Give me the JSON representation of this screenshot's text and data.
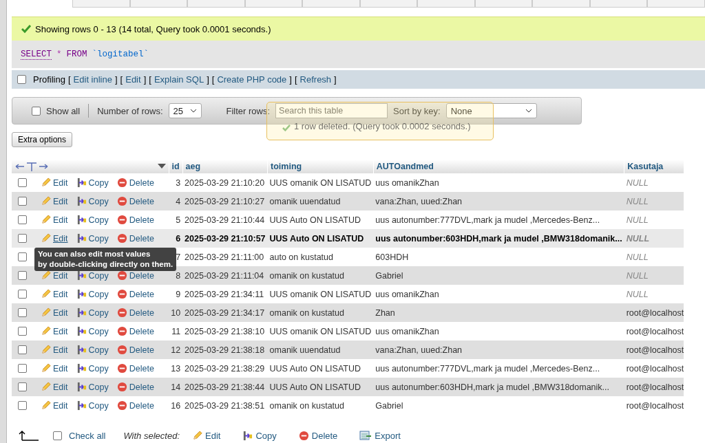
{
  "success": {
    "message": "Showing rows 0 - 13 (14 total, Query took 0.0001 seconds.)"
  },
  "sql": {
    "keyword_select": "SELECT",
    "star": "*",
    "keyword_from": "FROM",
    "table": "`logitabel`"
  },
  "profiling": {
    "label": "Profiling",
    "checked": false,
    "links": [
      {
        "open": "[",
        "label": "Edit inline",
        "close": "]"
      },
      {
        "open": "[",
        "label": "Edit",
        "close": "]"
      },
      {
        "open": "[",
        "label": "Explain SQL",
        "close": "]"
      },
      {
        "open": "[",
        "label": "Create PHP code",
        "close": "]"
      },
      {
        "open": "[",
        "label": "Refresh",
        "close": "]"
      }
    ]
  },
  "filter_bar": {
    "show_all": {
      "label": "Show all",
      "checked": false
    },
    "rows_label": "Number of rows:",
    "rows_value": "25",
    "filter_label": "Filter rows:",
    "filter_placeholder": "Search this table",
    "sort_label": "Sort by key:",
    "sort_value": "None"
  },
  "notification": {
    "message": "1 row deleted. (Query took 0.0002 seconds.)"
  },
  "extra_options": "Extra options",
  "table": {
    "columns": [
      "id",
      "aeg",
      "toiming",
      "AUTOandmed",
      "Kasutaja"
    ],
    "rows": [
      {
        "edit": "Edit",
        "copy": "Copy",
        "delete": "Delete",
        "id": "3",
        "aeg": "2025-03-29 21:10:20",
        "toiming": "UUS omanik ON LISATUD",
        "auto": "uus omanikZhan",
        "kasutaja": "NULL",
        "is_null": true,
        "hovered": false,
        "checked": false
      },
      {
        "edit": "Edit",
        "copy": "Copy",
        "delete": "Delete",
        "id": "4",
        "aeg": "2025-03-29 21:10:27",
        "toiming": "omanik uuendatud",
        "auto": "vana:Zhan, uued:Zhan",
        "kasutaja": "NULL",
        "is_null": true,
        "hovered": false,
        "checked": false
      },
      {
        "edit": "Edit",
        "copy": "Copy",
        "delete": "Delete",
        "id": "5",
        "aeg": "2025-03-29 21:10:44",
        "toiming": "UUS Auto ON LISATUD",
        "auto": "uus autonumber:777DVL,mark ja mudel ,Mercedes-Benz...",
        "kasutaja": "NULL",
        "is_null": true,
        "hovered": false,
        "checked": false
      },
      {
        "edit": "Edit",
        "copy": "Copy",
        "delete": "Delete",
        "id": "6",
        "aeg": "2025-03-29 21:10:57",
        "toiming": "UUS Auto ON LISATUD",
        "auto": "uus autonumber:603HDH,mark ja mudel ,BMW318domanik...",
        "kasutaja": "NULL",
        "is_null": true,
        "hovered": true,
        "checked": false
      },
      {
        "id": "7",
        "aeg": "2025-03-29 21:11:00",
        "toiming": "auto on kustatud",
        "auto": "603HDH",
        "kasutaja": "NULL",
        "is_null": true,
        "hovered": false,
        "checked": false
      },
      {
        "edit": "Edit",
        "copy": "Copy",
        "delete": "Delete",
        "id": "8",
        "aeg": "2025-03-29 21:11:04",
        "toiming": "omanik on kustatud",
        "auto": "Gabriel",
        "kasutaja": "NULL",
        "is_null": true,
        "hovered": false,
        "checked": false
      },
      {
        "edit": "Edit",
        "copy": "Copy",
        "delete": "Delete",
        "id": "9",
        "aeg": "2025-03-29 21:34:11",
        "toiming": "UUS omanik ON LISATUD",
        "auto": "uus omanikZhan",
        "kasutaja": "NULL",
        "is_null": true,
        "hovered": false,
        "checked": false
      },
      {
        "edit": "Edit",
        "copy": "Copy",
        "delete": "Delete",
        "id": "10",
        "aeg": "2025-03-29 21:34:17",
        "toiming": "omanik on kustatud",
        "auto": "Zhan",
        "kasutaja": "root@localhost",
        "is_null": false,
        "hovered": false,
        "checked": false
      },
      {
        "edit": "Edit",
        "copy": "Copy",
        "delete": "Delete",
        "id": "11",
        "aeg": "2025-03-29 21:38:10",
        "toiming": "UUS omanik ON LISATUD",
        "auto": "uus omanikZhan",
        "kasutaja": "root@localhost",
        "is_null": false,
        "hovered": false,
        "checked": false
      },
      {
        "edit": "Edit",
        "copy": "Copy",
        "delete": "Delete",
        "id": "12",
        "aeg": "2025-03-29 21:38:18",
        "toiming": "omanik uuendatud",
        "auto": "vana:Zhan, uued:Zhan",
        "kasutaja": "root@localhost",
        "is_null": false,
        "hovered": false,
        "checked": false
      },
      {
        "edit": "Edit",
        "copy": "Copy",
        "delete": "Delete",
        "id": "13",
        "aeg": "2025-03-29 21:38:29",
        "toiming": "UUS Auto ON LISATUD",
        "auto": "uus autonumber:777DVL,mark ja mudel ,Mercedes-Benz...",
        "kasutaja": "root@localhost",
        "is_null": false,
        "hovered": false,
        "checked": false
      },
      {
        "edit": "Edit",
        "copy": "Copy",
        "delete": "Delete",
        "id": "14",
        "aeg": "2025-03-29 21:38:44",
        "toiming": "UUS Auto ON LISATUD",
        "auto": "uus autonumber:603HDH,mark ja mudel ,BMW318domanik...",
        "kasutaja": "root@localhost",
        "is_null": false,
        "hovered": false,
        "checked": false
      },
      {
        "edit": "Edit",
        "copy": "Copy",
        "delete": "Delete",
        "id": "16",
        "aeg": "2025-03-29 21:38:51",
        "toiming": "omanik on kustatud",
        "auto": "Gabriel",
        "kasutaja": "root@localhost",
        "is_null": false,
        "hovered": false,
        "checked": false
      }
    ]
  },
  "tooltip": {
    "lines": [
      "You can also edit most values",
      "by double-clicking directly on them."
    ]
  },
  "footer": {
    "check_all": {
      "label": "Check all",
      "checked": false
    },
    "with_selected": "With selected:",
    "buttons": [
      {
        "kind": "edit",
        "label": "Edit"
      },
      {
        "kind": "copy",
        "label": "Copy"
      },
      {
        "kind": "delete",
        "label": "Delete"
      },
      {
        "kind": "export",
        "label": "Export"
      }
    ]
  }
}
